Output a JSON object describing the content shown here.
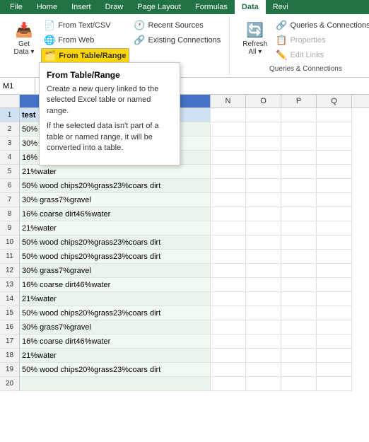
{
  "ribbon": {
    "tabs": [
      "File",
      "Home",
      "Insert",
      "Draw",
      "Page Layout",
      "Formulas",
      "Data",
      "Revi"
    ],
    "active_tab": "Data",
    "groups": {
      "get_data": {
        "label": "Get Data",
        "buttons": [
          {
            "id": "get-data",
            "label": "Get\nData",
            "icon": "📥",
            "large": true
          },
          {
            "id": "from-text-csv",
            "label": "From Text/CSV",
            "icon": "📄"
          },
          {
            "id": "from-web",
            "label": "From Web",
            "icon": "🌐"
          },
          {
            "id": "from-table-range",
            "label": "From Table/Range",
            "icon": "🗂️",
            "highlighted": true
          }
        ],
        "right_buttons": [
          {
            "id": "recent-sources",
            "label": "Recent Sources",
            "icon": "🕐"
          },
          {
            "id": "existing-connections",
            "label": "Existing Connections",
            "icon": "🔗"
          }
        ]
      },
      "refresh": {
        "label": "Queries & Connections",
        "buttons": [
          {
            "id": "refresh",
            "label": "Refresh\nAll",
            "icon": "🔄",
            "large": true
          },
          {
            "id": "queries-connections",
            "label": "Queries & Connections",
            "icon": "🔗"
          },
          {
            "id": "properties",
            "label": "Properties",
            "icon": "📋",
            "disabled": true
          },
          {
            "id": "edit-links",
            "label": "Edit Links",
            "icon": "✏️",
            "disabled": true
          }
        ]
      }
    }
  },
  "tooltip": {
    "title": "From Table/Range",
    "line1": "Create a new query linked to the selected Excel table or named range.",
    "line2": "If the selected data isn't part of a table or named range, it will be converted into a table."
  },
  "formula_bar": {
    "cell_ref": "M1",
    "icons": [
      "✗",
      "✓",
      "fx"
    ],
    "value": "test"
  },
  "column_headers": [
    "N",
    "O",
    "P",
    "Q"
  ],
  "row_data": [
    {
      "num": 1,
      "val": "test",
      "highlighted": true
    },
    {
      "num": 2,
      "val": "50%"
    },
    {
      "num": 3,
      "val": "30%"
    },
    {
      "num": 4,
      "val": "16% coarse dirt46%water"
    },
    {
      "num": 5,
      "val": "21%water"
    },
    {
      "num": 6,
      "val": "50% wood chips20%grass23%coars dirt"
    },
    {
      "num": 7,
      "val": "30% grass7%gravel"
    },
    {
      "num": 8,
      "val": "16% coarse dirt46%water"
    },
    {
      "num": 9,
      "val": "21%water"
    },
    {
      "num": 10,
      "val": "50% wood chips20%grass23%coars dirt"
    },
    {
      "num": 11,
      "val": "50% wood chips20%grass23%coars dirt"
    },
    {
      "num": 12,
      "val": "30% grass7%gravel"
    },
    {
      "num": 13,
      "val": "16% coarse dirt46%water"
    },
    {
      "num": 14,
      "val": "21%water"
    },
    {
      "num": 15,
      "val": "50% wood chips20%grass23%coars dirt"
    },
    {
      "num": 16,
      "val": "30% grass7%gravel"
    },
    {
      "num": 17,
      "val": "16% coarse dirt46%water"
    },
    {
      "num": 18,
      "val": "21%water"
    },
    {
      "num": 19,
      "val": "50% wood chips20%grass23%coars dirt"
    },
    {
      "num": 20,
      "val": ""
    }
  ]
}
